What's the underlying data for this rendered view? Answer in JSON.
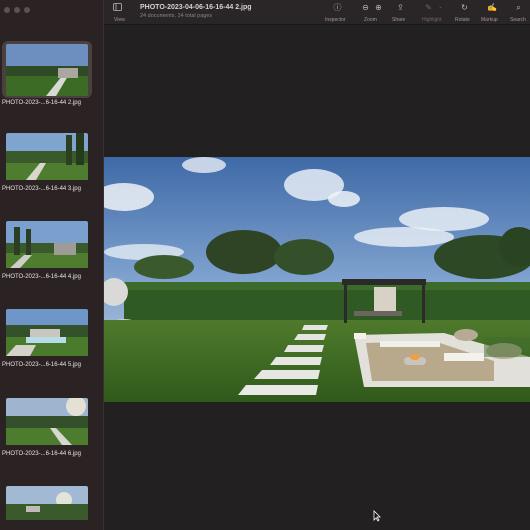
{
  "window": {
    "title": "PHOTO-2023-04-06-16-16-44 2.jpg",
    "subtitle": "24 documents, 24 total pages"
  },
  "toolbar": {
    "view_label": "View",
    "inspector_label": "Inspector",
    "zoom_label": "Zoom",
    "share_label": "Share",
    "highlight_label": "Highlight",
    "rotate_label": "Rotate",
    "markup_label": "Markup",
    "search_label": "Search"
  },
  "sidebar": {
    "items": [
      {
        "label": "PHOTO-2023-...6-16-44 2.jpg",
        "selected": true
      },
      {
        "label": "PHOTO-2023-...6-16-44 3.jpg",
        "selected": false
      },
      {
        "label": "PHOTO-2023-...6-16-44 4.jpg",
        "selected": false
      },
      {
        "label": "PHOTO-2023-...6-16-44 5.jpg",
        "selected": false
      },
      {
        "label": "PHOTO-2023-...6-16-44 6.jpg",
        "selected": false
      },
      {
        "label": "",
        "selected": false
      }
    ]
  },
  "colors": {
    "sidebar_bg": "#2b2223",
    "viewer_bg": "#232021",
    "toolbar_bg": "#2a2526",
    "selection_bg": "#49403f"
  },
  "icons": [
    "sidebar-toggle-icon",
    "inspector-icon",
    "zoom-out-icon",
    "zoom-in-icon",
    "share-icon",
    "highlight-icon",
    "rotate-icon",
    "markup-icon",
    "search-icon",
    "pointer-cursor-icon"
  ]
}
